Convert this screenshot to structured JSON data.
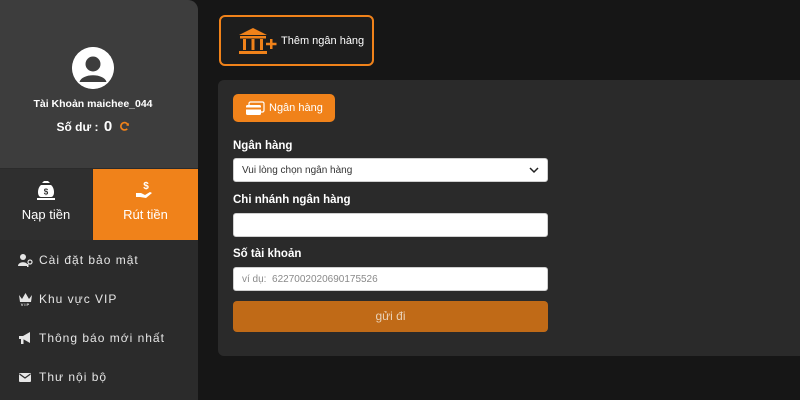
{
  "sidebar": {
    "account_label": "Tài Khoản maichee_044",
    "balance_label": "Số dư :",
    "balance_value": "0",
    "deposit_label": "Nạp tiền",
    "withdraw_label": "Rút tiền",
    "menu": [
      {
        "label": "Cài đặt bảo mật",
        "icon": "user-key-icon"
      },
      {
        "label": "Khu vực VIP",
        "icon": "vip-crown-icon"
      },
      {
        "label": "Thông báo mới nhất",
        "icon": "megaphone-icon"
      },
      {
        "label": "Thư nội bộ",
        "icon": "envelope-icon"
      }
    ]
  },
  "top": {
    "add_bank_label": "Thêm ngân hàng"
  },
  "form": {
    "tab_label": "Ngân hàng",
    "bank_label": "Ngân hàng",
    "bank_select_value": "Vui lòng chọn ngân hàng",
    "branch_label": "Chi nhánh ngân hàng",
    "branch_value": "",
    "account_label": "Số tài khoản",
    "account_placeholder": "ví dụ:  6227002020690175526",
    "submit_label": "gửi đi"
  },
  "colors": {
    "accent": "#f0821a",
    "submit": "#c06a17",
    "background": "#161616",
    "panel": "#2a2a2a"
  }
}
